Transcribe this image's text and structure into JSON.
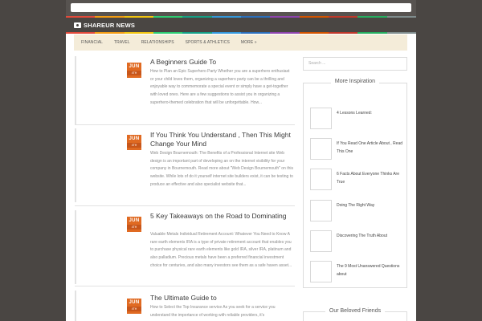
{
  "site": {
    "name": "SHAREUR NEWS",
    "icon": "camera-icon"
  },
  "colors": {
    "rainbow": [
      "#e24a3b",
      "#f39c12",
      "#f1c40f",
      "#2ecc71",
      "#16a085",
      "#3498db",
      "#2c6fbb",
      "#8e44ad",
      "#d35400",
      "#c0392b",
      "#27ae60",
      "#7f8c8d"
    ],
    "date_badge": "#e06a22"
  },
  "nav": {
    "items": [
      "FINANCIAL",
      "TRAVEL",
      "RELATIONSHIPS",
      "SPORTS & ATHLETICS",
      "MORE »"
    ]
  },
  "posts": [
    {
      "month": "JUN",
      "day": "4TH",
      "title": "A Beginners Guide To",
      "excerpt": "How to Plan an Epic Superhero Party Whether you are a superhero enthusiast or your child loves them, organizing a superhero party can be a thrilling and enjoyable way to commemorate a special event or simply have a get-together with loved ones. Here are a few suggestions to assist you in organizing a superhero-themed celebration that will be unforgettable. How..."
    },
    {
      "month": "JUN",
      "day": "4TH",
      "title": "If You Think You Understand , Then This Might Change Your Mind",
      "excerpt": "Web Design Bournemouth: The Benefits of a Professional Internet site Web design is an important part of developing an on the internet visibility for your company in Bournemouth. Read more about \"Web Design Bournemouth\" on this website. While lots of do it yourself internet site builders exist, it can be testing to produce an effective and also specialist website that..."
    },
    {
      "month": "JUN",
      "day": "4TH",
      "title": "5 Key Takeaways on the Road to Dominating",
      "excerpt": "Valuable Metals Individual Retirement Account: Whatever You Need to Know A rare earth elements IRA is a type of private retirement account that enables you to purchase physical rare earth elements like gold IRA, silver IRA, platinum and also palladium. Precious metals have been a preferred financial investment choice for centuries, and also many investors see them as a safe haven asset..."
    },
    {
      "month": "JUN",
      "day": "4TH",
      "title": "The Ultimate Guide to",
      "excerpt": "How to Select the Top Insurance service As you seek for a service you understand the importance of working with reliable providers, it's"
    }
  ],
  "sidebar": {
    "search_placeholder": "Search ...",
    "inspiration_title": "More Inspiration",
    "inspiration_items": [
      "4 Lessons Learned:",
      "If You Read One Article About , Read This One",
      "6 Facts About Everyone Thinks Are True",
      "Doing The Right Way",
      "Discovering The Truth About",
      "The 9 Most Unanswered Questions about"
    ],
    "friends_title": "Our Beloved Friends"
  }
}
